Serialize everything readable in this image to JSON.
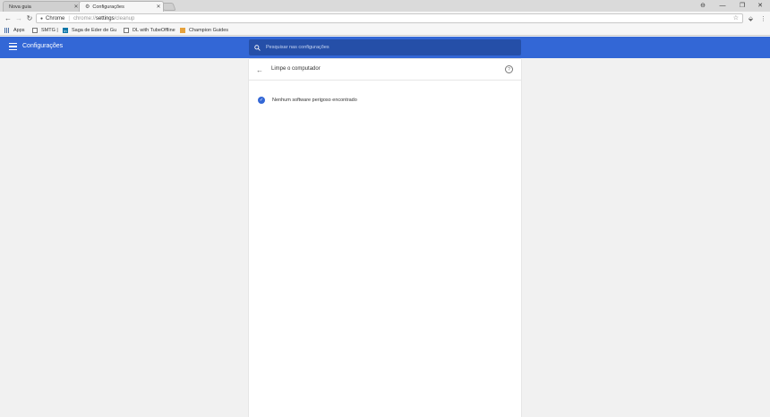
{
  "tabs": [
    {
      "label": "Nova guia"
    },
    {
      "label": "Configurações"
    }
  ],
  "toolbar": {
    "origin_label": "Chrome",
    "url_scheme": "chrome://",
    "url_host": "settings",
    "url_path": "/cleanup"
  },
  "bookmarks": [
    {
      "label": "Apps",
      "icon": "apps-icon"
    },
    {
      "label": "SMTG |",
      "icon": "page-icon"
    },
    {
      "label": "Saga de Eder de Gu",
      "icon": "linkedin-icon"
    },
    {
      "label": "DL with TubeOffline",
      "icon": "page-icon"
    },
    {
      "label": "Champion Guides",
      "icon": "folder-icon"
    }
  ],
  "header": {
    "title": "Configurações",
    "search_placeholder": "Pesquisar nas configurações"
  },
  "page": {
    "title": "Limpe o computador",
    "result": "Nenhum software perigoso encontrado"
  },
  "colors": {
    "header_bg": "#3367d6",
    "search_bg": "#254fa8",
    "accent": "#3367d6"
  }
}
